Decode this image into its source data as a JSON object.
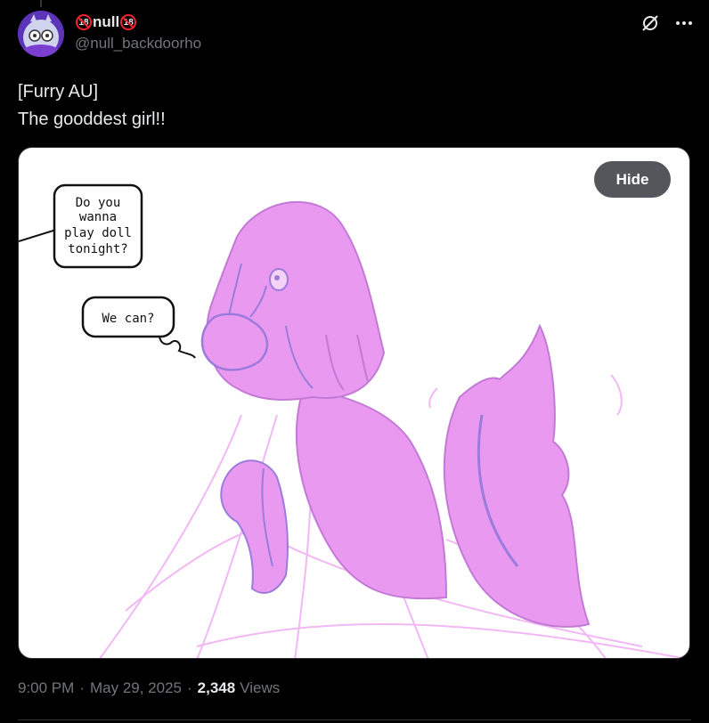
{
  "author": {
    "display_name": "null",
    "badge_text": "18",
    "handle": "@null_backdoorho"
  },
  "tweet": {
    "line1": "[Furry AU]",
    "line2": "The gooddest girl!!"
  },
  "media": {
    "hide_label": "Hide",
    "bubble1": [
      "Do you",
      "wanna",
      "play doll",
      "tonight?"
    ],
    "bubble2": "We can?"
  },
  "meta": {
    "time": "9:00 PM",
    "date": "May 29, 2025",
    "views_count": "2,348",
    "views_label": "Views"
  },
  "icons": {
    "grok": "slashed-circle-icon",
    "more": "more-dots-icon"
  },
  "colors": {
    "background": "#000000",
    "text": "#e7e9ea",
    "muted": "#71767b",
    "badge_red": "#f4212e",
    "character_pink": "#e99af0",
    "character_purple": "#9b7bdc"
  }
}
